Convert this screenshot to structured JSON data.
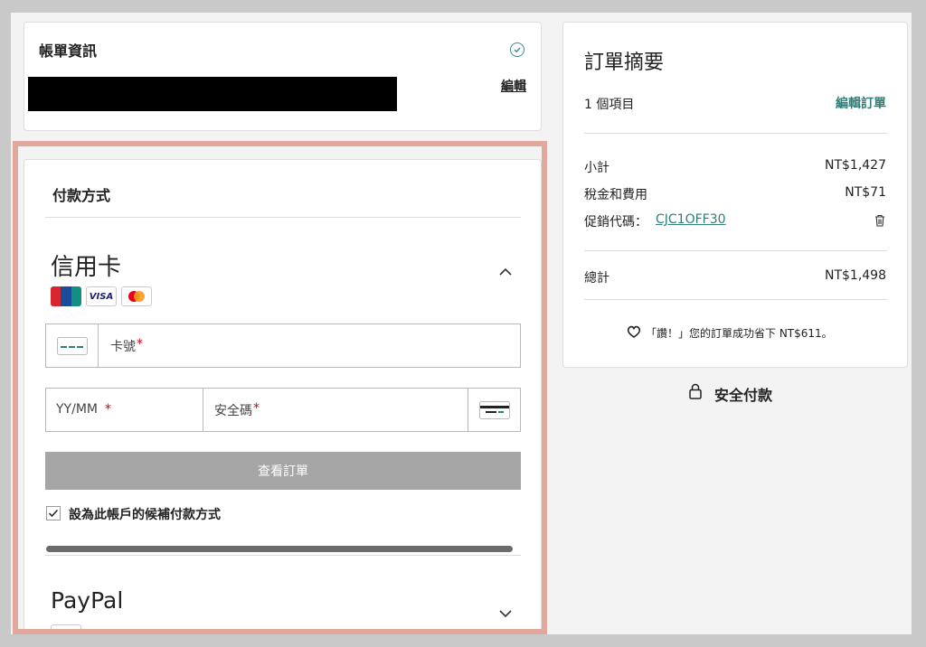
{
  "account": {
    "title": "帳單資訊",
    "edit_label": "編輯"
  },
  "payment": {
    "section_title": "付款方式",
    "credit_card": {
      "title": "信用卡",
      "brands": [
        "UnionPay 銀聯",
        "VISA",
        "Mastercard"
      ],
      "card_number_placeholder": "卡號",
      "expiry_placeholder": "YY/MM",
      "cvc_placeholder": "安全碼",
      "required_mark": "*"
    },
    "review_button": "查看訂單",
    "save_default_label": "設為此帳戶的候補付款方式",
    "save_default_checked": true,
    "paypal_title": "PayPal"
  },
  "summary": {
    "title": "訂單摘要",
    "items_count": "1 個項目",
    "edit_order": "編輯訂單",
    "subtotal_label": "小計",
    "subtotal_value": "NT$1,427",
    "tax_label": "稅金和費用",
    "tax_value": "NT$71",
    "promo_label": "促銷代碼：",
    "promo_code": "CJC1OFF30",
    "total_label": "總計",
    "total_value": "NT$1,498",
    "savings_text": "「讚！」您的訂單成功省下 NT$611。"
  },
  "secure_payment": "安全付款",
  "colors": {
    "accent": "#2f7f7a",
    "highlight": "#e2a79d",
    "button_disabled": "#a6a6a6"
  }
}
